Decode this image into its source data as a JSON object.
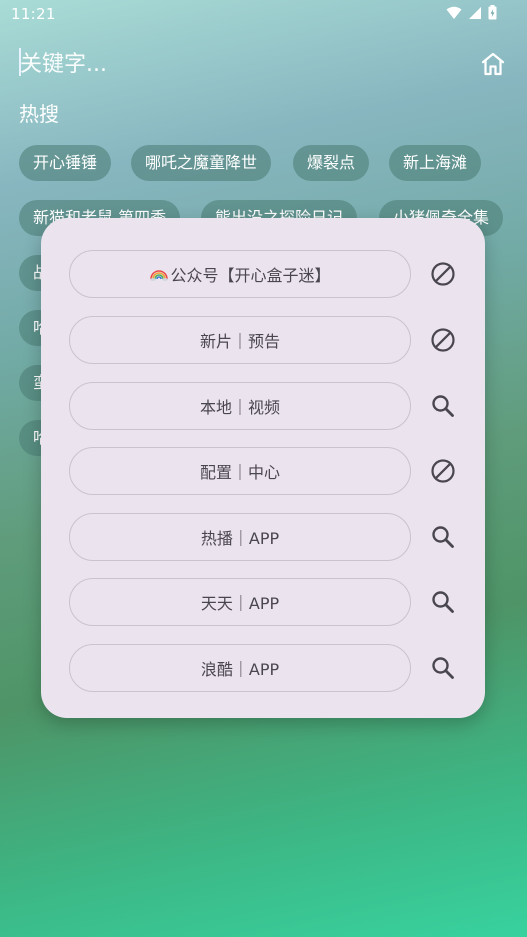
{
  "status": {
    "time": "11:21"
  },
  "search": {
    "placeholder": "关键字..."
  },
  "hot": {
    "title": "热搜",
    "chips": [
      "开心锤锤",
      "哪吒之魔童降世",
      "爆裂点",
      "新上海滩",
      "新猫和老鼠 第四季",
      "熊出没之探险日记",
      "小猪佩奇全集",
      "战",
      "哈",
      "蛮",
      "哈"
    ]
  },
  "sources": [
    {
      "label": "公众号【开心盒子迷】",
      "rainbow_icon": true,
      "action_icon": "block-icon"
    },
    {
      "label": "新片｜预告",
      "action_icon": "block-icon"
    },
    {
      "label": "本地｜视频",
      "action_icon": "search-icon"
    },
    {
      "label": "配置｜中心",
      "action_icon": "block-icon"
    },
    {
      "label": "热播｜APP",
      "action_icon": "search-icon"
    },
    {
      "label": "天天｜APP",
      "action_icon": "search-icon"
    },
    {
      "label": "浪酷｜APP",
      "action_icon": "search-icon"
    }
  ],
  "colors": {
    "popup_bg": "#ebe4ee",
    "chip_bg": "#4b7d76",
    "text_dark": "#4a4650"
  }
}
